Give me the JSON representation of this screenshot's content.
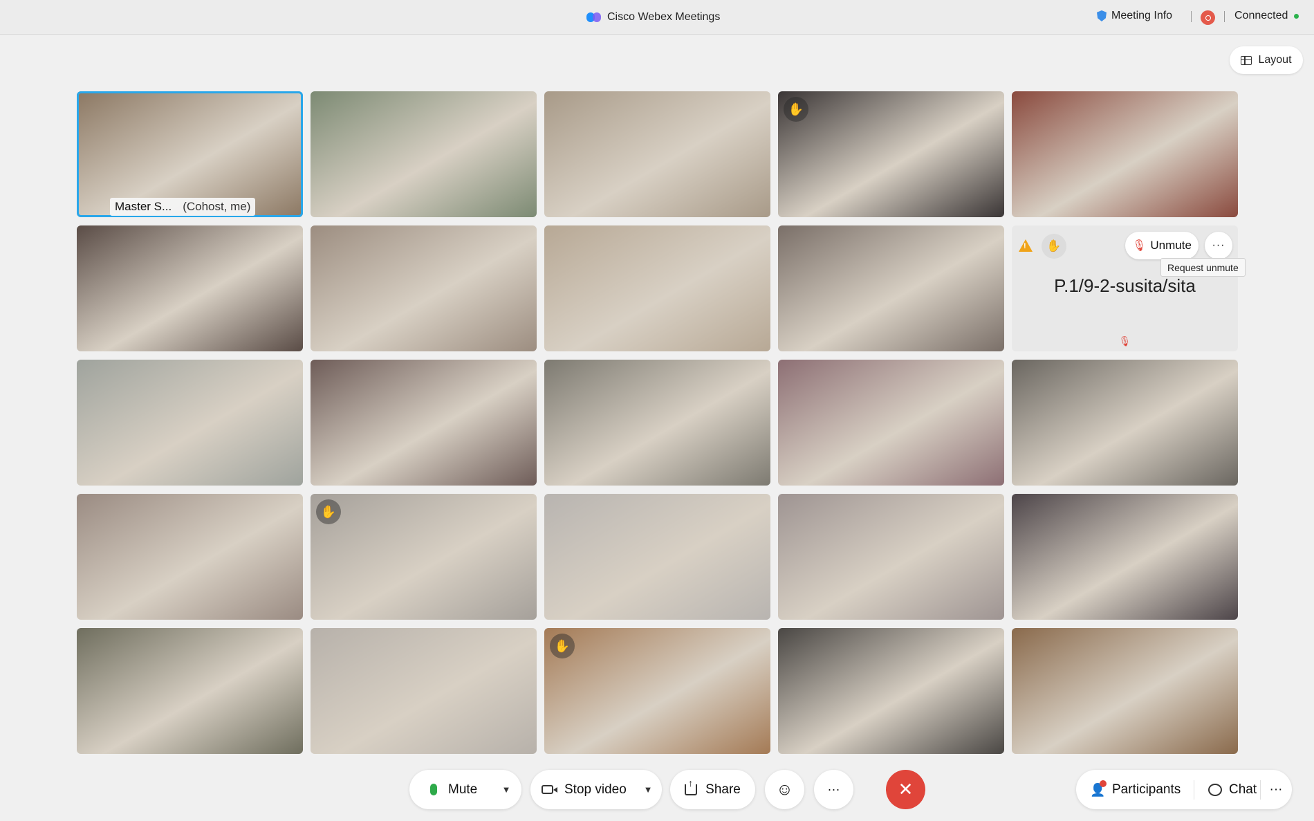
{
  "titlebar": {
    "app_title": "Cisco Webex Meetings",
    "meeting_info": "Meeting Info",
    "status": "Connected",
    "status_color": "#2bb24c"
  },
  "layout_button": "Layout",
  "tiles": [
    {
      "type": "video",
      "bg": "#8b7762",
      "active": true
    },
    {
      "type": "video",
      "bg": "#7c8a73"
    },
    {
      "type": "video",
      "bg": "#a89a88"
    },
    {
      "type": "video",
      "bg": "#3a3535",
      "hand": true
    },
    {
      "type": "video",
      "bg": "#8a4a3e"
    },
    {
      "type": "video",
      "bg": "#5a4c46"
    },
    {
      "type": "video",
      "bg": "#9c8d80"
    },
    {
      "type": "video",
      "bg": "#b7a895"
    },
    {
      "type": "video",
      "bg": "#7a6f68"
    },
    {
      "type": "audio"
    },
    {
      "type": "video",
      "bg": "#9fa39d"
    },
    {
      "type": "video",
      "bg": "#6e5c58"
    },
    {
      "type": "video",
      "bg": "#7d7a71"
    },
    {
      "type": "video",
      "bg": "#8d6f74"
    },
    {
      "type": "video",
      "bg": "#6a6660"
    },
    {
      "type": "video",
      "bg": "#9a8b82"
    },
    {
      "type": "video",
      "bg": "#a5a09a",
      "hand": true
    },
    {
      "type": "video",
      "bg": "#b8b4b0"
    },
    {
      "type": "video",
      "bg": "#9e9492"
    },
    {
      "type": "video",
      "bg": "#4d4549"
    },
    {
      "type": "video",
      "bg": "#6f6e5e"
    },
    {
      "type": "video",
      "bg": "#b7b1aa"
    },
    {
      "type": "video",
      "bg": "#a47a55",
      "hand": true
    },
    {
      "type": "video",
      "bg": "#4a4744"
    },
    {
      "type": "video",
      "bg": "#8a6a4c"
    }
  ],
  "self_tile": {
    "name": "Master S...",
    "role": "(Cohost, me)"
  },
  "audio_tile": {
    "name": "P.1/9-2-susita/sita",
    "unmute_label": "Unmute",
    "more_label": "···",
    "tooltip": "Request unmute"
  },
  "controls": {
    "mute": "Mute",
    "stop_video": "Stop video",
    "share": "Share",
    "more": "···",
    "participants": "Participants",
    "chat": "Chat",
    "overflow": "···"
  }
}
